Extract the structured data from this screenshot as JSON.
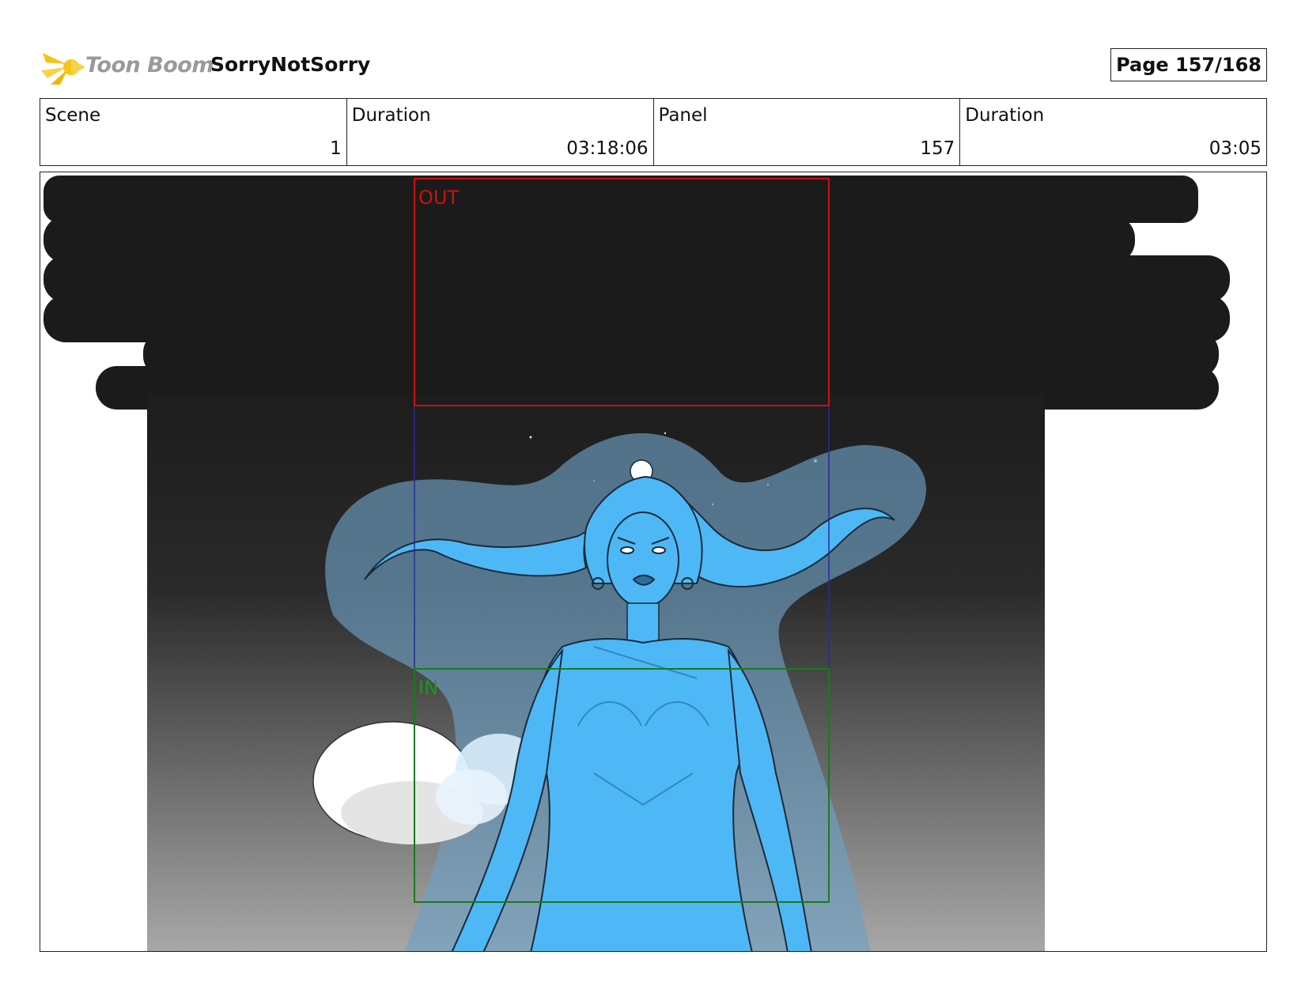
{
  "header": {
    "brand": "Toon Boom",
    "project": "SorryNotSorry",
    "page": "Page 157/168"
  },
  "info": {
    "scene_label": "Scene",
    "scene_value": "1",
    "scene_duration_label": "Duration",
    "scene_duration_value": "03:18:06",
    "panel_label": "Panel",
    "panel_value": "157",
    "panel_duration_label": "Duration",
    "panel_duration_value": "03:05"
  },
  "frames": {
    "out_label": "OUT",
    "in_label": "IN",
    "out_color": "#cc1111",
    "in_color": "#1a7a1a",
    "path_color": "#2a2a9a"
  },
  "colors": {
    "logo_yellow": "#f5c518",
    "character_blue": "#4db8f5",
    "hair_glow": "#6f9fc4",
    "sky_top": "#1c1c1c",
    "sky_bottom": "#a8a8a8"
  }
}
